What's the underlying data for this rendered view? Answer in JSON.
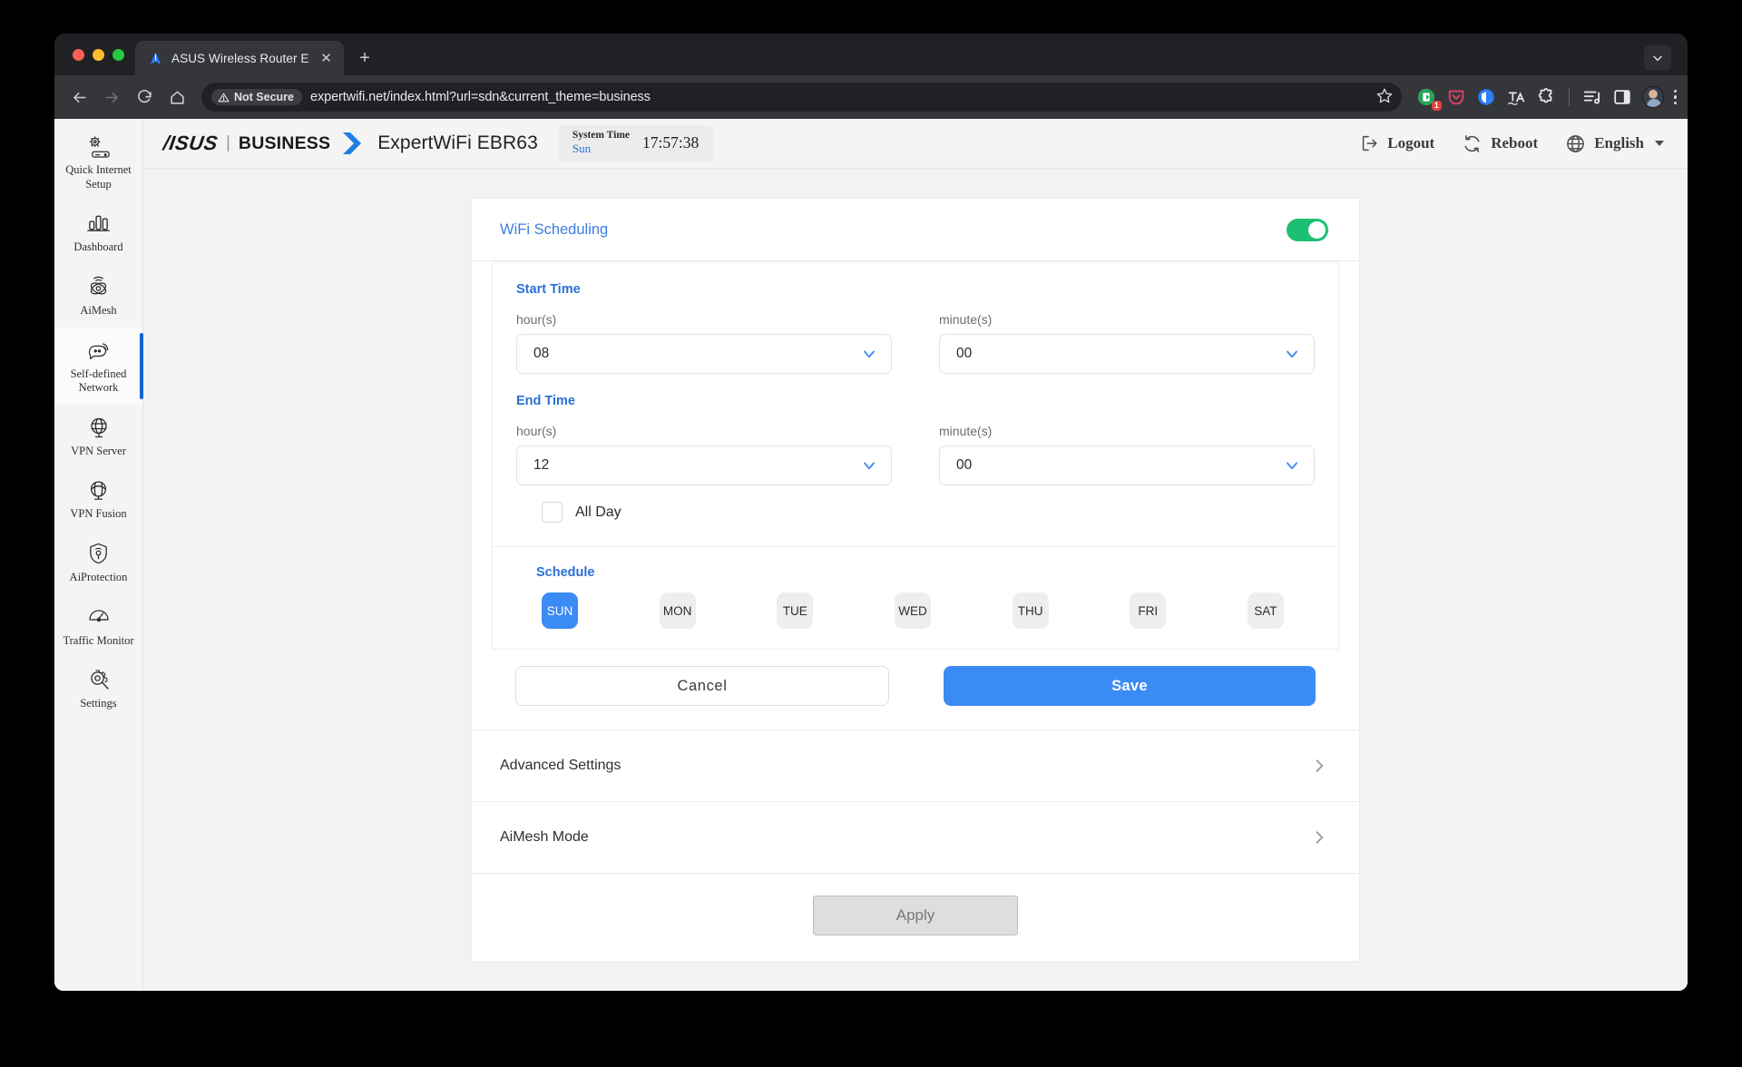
{
  "browser": {
    "tab": {
      "title": "ASUS Wireless Router Expert",
      "favicon_icon": "asus-logo-icon",
      "close_icon": "close-icon"
    },
    "new_tab_label": "+",
    "tab_list_icon": "chevron-down-icon",
    "nav": {
      "back_icon": "arrow-left-icon",
      "forward_icon": "arrow-right-icon",
      "reload_icon": "reload-icon",
      "home_icon": "home-icon"
    },
    "omnibox": {
      "security_label": "Not Secure",
      "security_icon": "warning-triangle-icon",
      "url": "expertwifi.net/index.html?url=sdn&current_theme=business",
      "bookmark_icon": "star-icon"
    },
    "extensions": [
      {
        "name": "extension-green-icon",
        "badge": "1"
      },
      {
        "name": "pocket-shield-icon",
        "badge": ""
      },
      {
        "name": "bitwarden-icon",
        "badge": ""
      },
      {
        "name": "translate-icon",
        "badge": ""
      },
      {
        "name": "puzzle-extensions-icon",
        "badge": ""
      }
    ],
    "toolbar_right": {
      "reading_list_icon": "reading-list-icon",
      "side_panel_icon": "side-panel-icon",
      "profile_icon": "avatar",
      "menu_icon": "kebab-menu-icon"
    }
  },
  "sidebar": {
    "items": [
      {
        "label": "Quick Internet Setup",
        "icon": "quick-internet-setup-icon",
        "active": false
      },
      {
        "label": "Dashboard",
        "icon": "dashboard-icon",
        "active": false
      },
      {
        "label": "AiMesh",
        "icon": "aimesh-icon",
        "active": false
      },
      {
        "label": "Self-defined Network",
        "icon": "self-defined-network-icon",
        "active": true
      },
      {
        "label": "VPN Server",
        "icon": "vpn-server-icon",
        "active": false
      },
      {
        "label": "VPN Fusion",
        "icon": "vpn-fusion-icon",
        "active": false
      },
      {
        "label": "AiProtection",
        "icon": "aiprotection-icon",
        "active": false
      },
      {
        "label": "Traffic Monitor",
        "icon": "traffic-monitor-icon",
        "active": false
      },
      {
        "label": "Settings",
        "icon": "settings-gear-icon",
        "active": false
      }
    ]
  },
  "appbar": {
    "logo": "/ISUS",
    "separator": "|",
    "business": "BUSINESS",
    "model": "ExpertWiFi EBR63",
    "system_time": {
      "label": "System Time",
      "day": "Sun",
      "clock": "17:57:38"
    },
    "logout_label": "Logout",
    "logout_icon": "logout-icon",
    "reboot_label": "Reboot",
    "reboot_icon": "reboot-icon",
    "language_label": "English",
    "language_icon": "globe-icon"
  },
  "panel": {
    "wifi_scheduling": {
      "title": "WiFi Scheduling",
      "enabled": true
    },
    "start_time": {
      "group_title": "Start Time",
      "hour_label": "hour(s)",
      "hour_value": "08",
      "minute_label": "minute(s)",
      "minute_value": "00"
    },
    "end_time": {
      "group_title": "End Time",
      "hour_label": "hour(s)",
      "hour_value": "12",
      "minute_label": "minute(s)",
      "minute_value": "00"
    },
    "all_day": {
      "label": "All Day",
      "checked": false
    },
    "schedule": {
      "title": "Schedule",
      "days": [
        {
          "label": "SUN",
          "active": true
        },
        {
          "label": "MON",
          "active": false
        },
        {
          "label": "TUE",
          "active": false
        },
        {
          "label": "WED",
          "active": false
        },
        {
          "label": "THU",
          "active": false
        },
        {
          "label": "FRI",
          "active": false
        },
        {
          "label": "SAT",
          "active": false
        }
      ]
    },
    "actions": {
      "cancel_label": "Cancel",
      "save_label": "Save"
    },
    "rows": [
      {
        "label": "Advanced Settings",
        "chevron": "chevron-right-icon"
      },
      {
        "label": "AiMesh Mode",
        "chevron": "chevron-right-icon"
      }
    ],
    "apply_label": "Apply"
  },
  "colors": {
    "accent_blue": "#3b8bf5",
    "link_blue": "#2a6fd6",
    "toggle_green": "#1dbf73",
    "active_nav": "#1565d8"
  }
}
